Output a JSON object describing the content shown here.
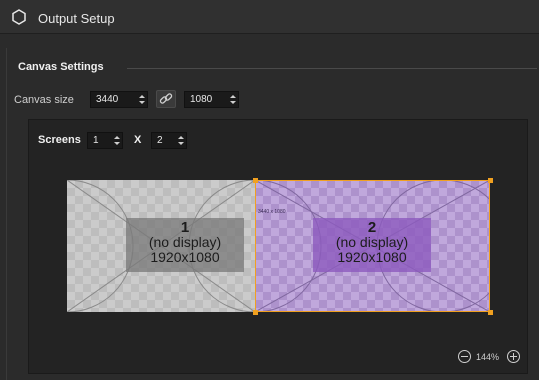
{
  "window": {
    "title": "Output Setup",
    "icon": "hexagon-icon"
  },
  "canvas_settings": {
    "section_title": "Canvas Settings",
    "size_label": "Canvas size",
    "width": "3440",
    "height": "1080",
    "link_icon": "link-icon"
  },
  "screens": {
    "label": "Screens",
    "columns": "1",
    "separator": "X",
    "rows": "2",
    "items": [
      {
        "number": "1",
        "status": "(no display)",
        "resolution": "1920x1080"
      },
      {
        "number": "2",
        "status": "(no display)",
        "resolution": "1920x1080"
      }
    ],
    "canvas_overlay_text": "3440 x 1080"
  },
  "zoom": {
    "level": "144%"
  },
  "colors": {
    "selection": "#f0a020",
    "screen2_tint": "#b39bd0",
    "accent_info2": "#8c5abe"
  }
}
